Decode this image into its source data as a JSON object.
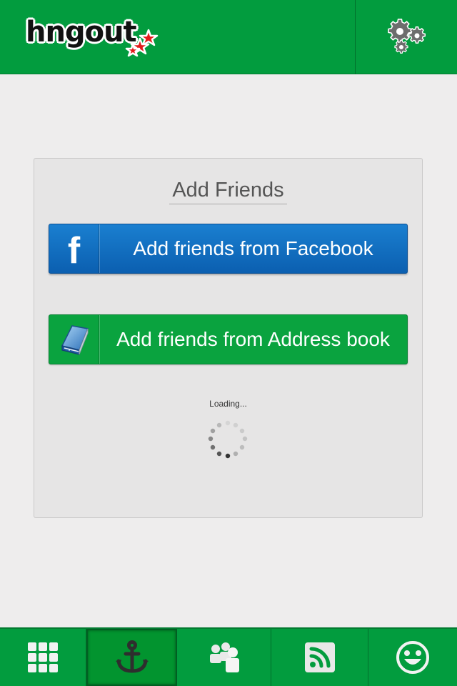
{
  "header": {
    "logo_text": "hngout",
    "settings_icon": "gears-icon"
  },
  "panel": {
    "title": "Add Friends",
    "facebook_button": {
      "label": "Add friends from Facebook",
      "icon": "facebook-icon",
      "icon_text": "f"
    },
    "address_book_button": {
      "label": "Add friends from Address book",
      "icon": "address-book-icon"
    },
    "loading_text": "Loading..."
  },
  "nav": {
    "items": [
      {
        "name": "grid",
        "icon": "grid-icon"
      },
      {
        "name": "anchor",
        "icon": "anchor-icon",
        "active": true
      },
      {
        "name": "people",
        "icon": "people-icon"
      },
      {
        "name": "feed",
        "icon": "rss-icon"
      },
      {
        "name": "profile",
        "icon": "smiley-icon"
      }
    ]
  },
  "colors": {
    "brand_green": "#029c3e",
    "facebook_blue": "#1a7fd0",
    "panel_bg": "#e6e5e5"
  }
}
